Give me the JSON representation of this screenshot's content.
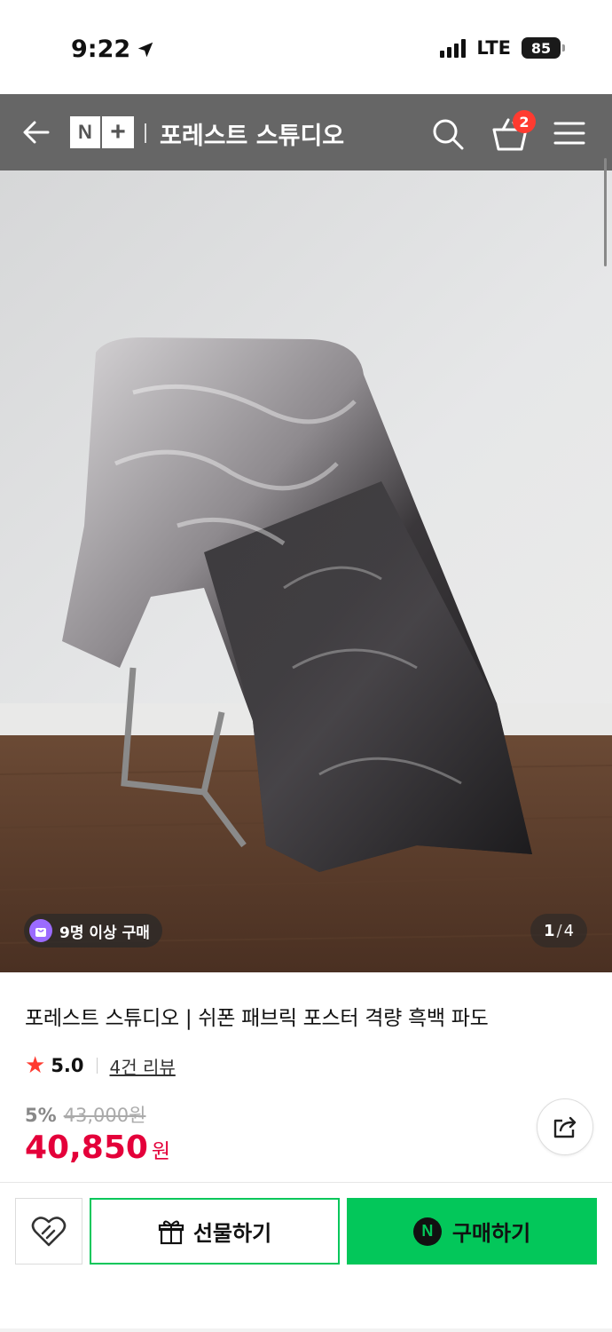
{
  "status_bar": {
    "time": "9:22",
    "network": "LTE",
    "battery": "85"
  },
  "header": {
    "logo_n": "N",
    "logo_plus": "+",
    "store_name": "포레스트 스튜디오",
    "cart_count": "2"
  },
  "gallery": {
    "buyers_badge": "9명 이상 구매",
    "current_page": "1",
    "total_pages": "4"
  },
  "product": {
    "title": "포레스트 스튜디오 | 쉬폰 패브릭 포스터 격량 흑백 파도",
    "rating": "5.0",
    "review_link": "4건 리뷰",
    "discount": "5%",
    "original_price": "43,000원",
    "price": "40,850",
    "price_unit": "원"
  },
  "actions": {
    "gift_label": "선물하기",
    "buy_label": "구매하기",
    "npay_mark": "N"
  },
  "colors": {
    "header_bg": "#666666",
    "accent_green": "#03c75a",
    "price_red": "#e4003a",
    "star": "#ff3b30"
  },
  "icons": [
    "location-arrow-icon",
    "back-arrow-icon",
    "search-icon",
    "cart-icon",
    "menu-icon",
    "bag-icon",
    "star-icon",
    "share-icon",
    "heart-icon",
    "gift-icon",
    "npay-icon"
  ]
}
